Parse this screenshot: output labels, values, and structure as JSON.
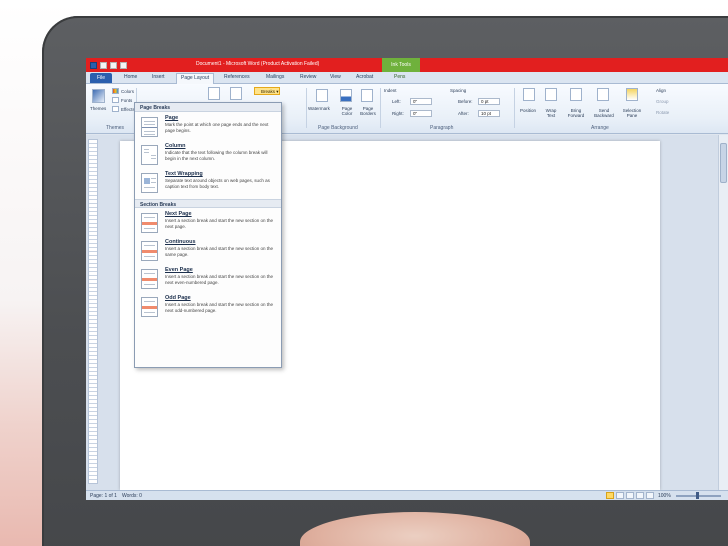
{
  "window": {
    "title": "Document1 - Microsoft Word (Product Activation Failed)",
    "context_tab_group": "Ink Tools"
  },
  "tabs": [
    {
      "label": "File"
    },
    {
      "label": "Home"
    },
    {
      "label": "Insert"
    },
    {
      "label": "Page Layout"
    },
    {
      "label": "References"
    },
    {
      "label": "Mailings"
    },
    {
      "label": "Review"
    },
    {
      "label": "View"
    },
    {
      "label": "Acrobat"
    },
    {
      "label": "Pens"
    }
  ],
  "ribbon": {
    "themes": {
      "button": "Themes",
      "colors": "Colors",
      "fonts": "Fonts",
      "effects": "Effects",
      "group": "Themes"
    },
    "breaks_label": "Breaks",
    "page_background": {
      "group": "Page Background",
      "watermark": "Watermark",
      "page_color": "Page Color",
      "page_borders": "Page Borders"
    },
    "paragraph": {
      "group": "Paragraph",
      "indent": "Indent",
      "left_label": "Left:",
      "left_value": "0\"",
      "right_label": "Right:",
      "right_value": "0\"",
      "spacing": "Spacing",
      "before_label": "Before:",
      "before_value": "0 pt",
      "after_label": "After:",
      "after_value": "10 pt"
    },
    "arrange": {
      "group": "Arrange",
      "position": "Position",
      "wrap_text": "Wrap Text",
      "bring_forward": "Bring Forward",
      "send_backward": "Send Backward",
      "selection_pane": "Selection Pane",
      "align": "Align",
      "group_btn": "Group",
      "rotate": "Rotate"
    }
  },
  "breaks_menu": {
    "page_breaks_header": "Page Breaks",
    "section_breaks_header": "Section Breaks",
    "page_items": [
      {
        "title": "Page",
        "desc": "Mark the point at which one page ends and the next page begins."
      },
      {
        "title": "Column",
        "desc": "Indicate that the text following the column break will begin in the next column."
      },
      {
        "title": "Text Wrapping",
        "desc": "Separate text around objects on web pages, such as caption text from body text."
      }
    ],
    "section_items": [
      {
        "title": "Next Page",
        "desc": "Insert a section break and start the new section on the next page."
      },
      {
        "title": "Continuous",
        "desc": "Insert a section break and start the new section on the same page."
      },
      {
        "title": "Even Page",
        "desc": "Insert a section break and start the new section on the next even-numbered page."
      },
      {
        "title": "Odd Page",
        "desc": "Insert a section break and start the new section on the next odd-numbered page."
      }
    ]
  },
  "status": {
    "page": "Page: 1 of 1",
    "words": "Words: 0",
    "zoom": "100%"
  },
  "colors": {
    "title_bar": "#e21f1f",
    "ink_tools": "#6fb13c",
    "file_tab": "#2a5fae",
    "bezel": "#4c4e51"
  }
}
